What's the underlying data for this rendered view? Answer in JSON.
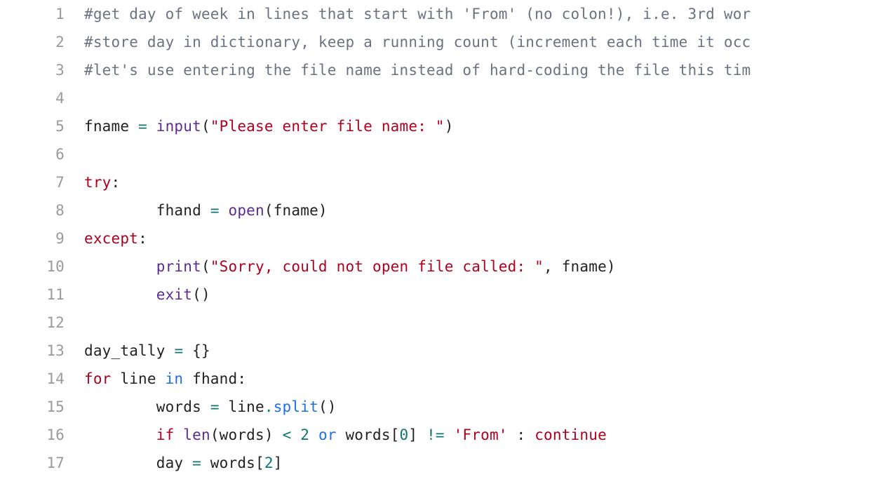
{
  "editor": {
    "lines": [
      {
        "num": "1",
        "indent": "",
        "tokens": [
          {
            "cls": "t-comment",
            "text": "#get day of week in lines that start with 'From' (no colon!), i.e. 3rd wor"
          }
        ]
      },
      {
        "num": "2",
        "indent": "",
        "tokens": [
          {
            "cls": "t-comment",
            "text": "#store day in dictionary, keep a running count (increment each time it occ"
          }
        ]
      },
      {
        "num": "3",
        "indent": "",
        "tokens": [
          {
            "cls": "t-comment",
            "text": "#let's use entering the file name instead of hard-coding the file this tim"
          }
        ]
      },
      {
        "num": "4",
        "indent": "",
        "tokens": []
      },
      {
        "num": "5",
        "indent": "",
        "tokens": [
          {
            "cls": "t-default",
            "text": "fname "
          },
          {
            "cls": "t-op",
            "text": "="
          },
          {
            "cls": "t-default",
            "text": " "
          },
          {
            "cls": "t-builtin",
            "text": "input"
          },
          {
            "cls": "t-default",
            "text": "("
          },
          {
            "cls": "t-string",
            "text": "\"Please enter file name: \""
          },
          {
            "cls": "t-default",
            "text": ")"
          }
        ]
      },
      {
        "num": "6",
        "indent": "",
        "tokens": []
      },
      {
        "num": "7",
        "indent": "",
        "tokens": [
          {
            "cls": "t-keyword",
            "text": "try"
          },
          {
            "cls": "t-default",
            "text": ":"
          }
        ]
      },
      {
        "num": "8",
        "indent": "        ",
        "tokens": [
          {
            "cls": "t-default",
            "text": "fhand "
          },
          {
            "cls": "t-op",
            "text": "="
          },
          {
            "cls": "t-default",
            "text": " "
          },
          {
            "cls": "t-builtin",
            "text": "open"
          },
          {
            "cls": "t-default",
            "text": "(fname)"
          }
        ]
      },
      {
        "num": "9",
        "indent": "",
        "tokens": [
          {
            "cls": "t-keyword",
            "text": "except"
          },
          {
            "cls": "t-default",
            "text": ":"
          }
        ]
      },
      {
        "num": "10",
        "indent": "        ",
        "tokens": [
          {
            "cls": "t-builtin",
            "text": "print"
          },
          {
            "cls": "t-default",
            "text": "("
          },
          {
            "cls": "t-string",
            "text": "\"Sorry, could not open file called: \""
          },
          {
            "cls": "t-default",
            "text": ", fname)"
          }
        ]
      },
      {
        "num": "11",
        "indent": "        ",
        "tokens": [
          {
            "cls": "t-builtin",
            "text": "exit"
          },
          {
            "cls": "t-default",
            "text": "()"
          }
        ]
      },
      {
        "num": "12",
        "indent": "",
        "tokens": []
      },
      {
        "num": "13",
        "indent": "",
        "tokens": [
          {
            "cls": "t-default",
            "text": "day_tally "
          },
          {
            "cls": "t-op",
            "text": "="
          },
          {
            "cls": "t-default",
            "text": " {}"
          }
        ]
      },
      {
        "num": "14",
        "indent": "",
        "tokens": [
          {
            "cls": "t-keyword",
            "text": "for"
          },
          {
            "cls": "t-default",
            "text": " line "
          },
          {
            "cls": "t-kwblue",
            "text": "in"
          },
          {
            "cls": "t-default",
            "text": " fhand:"
          }
        ]
      },
      {
        "num": "15",
        "indent": "        ",
        "tokens": [
          {
            "cls": "t-default",
            "text": "words "
          },
          {
            "cls": "t-op",
            "text": "="
          },
          {
            "cls": "t-default",
            "text": " line"
          },
          {
            "cls": "t-op",
            "text": "."
          },
          {
            "cls": "t-def",
            "text": "split"
          },
          {
            "cls": "t-default",
            "text": "()"
          }
        ]
      },
      {
        "num": "16",
        "indent": "        ",
        "tokens": [
          {
            "cls": "t-keyword",
            "text": "if"
          },
          {
            "cls": "t-default",
            "text": " "
          },
          {
            "cls": "t-builtin",
            "text": "len"
          },
          {
            "cls": "t-default",
            "text": "(words) "
          },
          {
            "cls": "t-op",
            "text": "<"
          },
          {
            "cls": "t-default",
            "text": " "
          },
          {
            "cls": "t-number",
            "text": "2"
          },
          {
            "cls": "t-default",
            "text": " "
          },
          {
            "cls": "t-kwblue",
            "text": "or"
          },
          {
            "cls": "t-default",
            "text": " words["
          },
          {
            "cls": "t-number",
            "text": "0"
          },
          {
            "cls": "t-default",
            "text": "] "
          },
          {
            "cls": "t-op",
            "text": "!="
          },
          {
            "cls": "t-default",
            "text": " "
          },
          {
            "cls": "t-string",
            "text": "'From'"
          },
          {
            "cls": "t-default",
            "text": " : "
          },
          {
            "cls": "t-keyword",
            "text": "continue"
          }
        ]
      },
      {
        "num": "17",
        "indent": "        ",
        "tokens": [
          {
            "cls": "t-default",
            "text": "day "
          },
          {
            "cls": "t-op",
            "text": "="
          },
          {
            "cls": "t-default",
            "text": " words["
          },
          {
            "cls": "t-number",
            "text": "2"
          },
          {
            "cls": "t-default",
            "text": "]"
          }
        ]
      }
    ]
  }
}
